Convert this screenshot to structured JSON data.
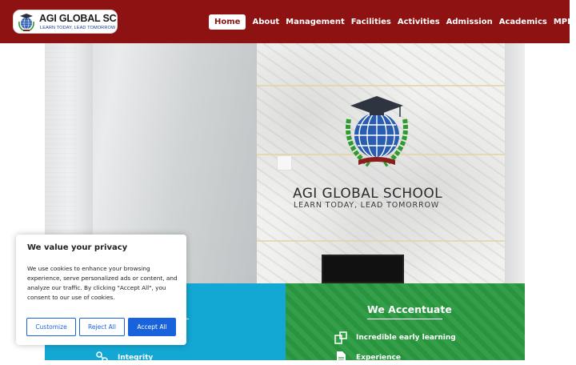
{
  "header": {
    "logo": {
      "name": "AGI GLOBAL SCHOOL",
      "tagline": "LEARN TODAY, LEAD TOMORROW"
    },
    "nav": [
      {
        "label": "Home",
        "active": true
      },
      {
        "label": "About"
      },
      {
        "label": "Management"
      },
      {
        "label": "Facilities"
      },
      {
        "label": "Activities"
      },
      {
        "label": "Admission"
      },
      {
        "label": "Academics"
      },
      {
        "label": "MPD"
      }
    ],
    "colors": {
      "bar": "#8e1212",
      "active_text": "#8e1212"
    }
  },
  "hero": {
    "sign": {
      "name": "AGI GLOBAL SCHOOL",
      "tagline": "LEARN TODAY, LEAD TOMORROW"
    }
  },
  "panels": {
    "left": {
      "title": "e",
      "color": "#13a7d4",
      "features": [
        {
          "icon": "handshake-icon",
          "label": "Integrity"
        }
      ]
    },
    "right": {
      "title": "We Accentuate",
      "color": "#2a9940",
      "features": [
        {
          "icon": "blocks-icon",
          "label": "Incredible early learning"
        },
        {
          "icon": "document-icon",
          "label": "Experience"
        }
      ]
    }
  },
  "cookie": {
    "title": "We value your privacy",
    "body": "We use cookies to enhance your browsing experience, serve personalized ads or content, and analyze our traffic. By clicking \"Accept All\", you consent to our use of cookies.",
    "buttons": {
      "customize": "Customize",
      "reject": "Reject All",
      "accept": "Accept All"
    },
    "accent": "#1863dc"
  }
}
